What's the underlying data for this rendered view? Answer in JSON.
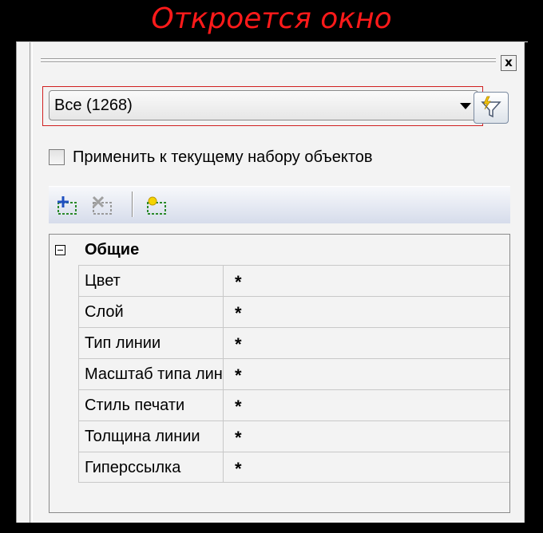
{
  "caption": "Откроется окно",
  "window": {
    "close_glyph": "x"
  },
  "dropdown": {
    "selected_value": "Все (1268)"
  },
  "filter_button": {
    "icon": "quick-select-filter-icon",
    "accent_color": "#f5c400"
  },
  "checkbox": {
    "label": "Применить к текущему набору объектов",
    "checked": false
  },
  "toolbar": {
    "icons": [
      "add-to-selection-icon",
      "remove-from-selection-icon",
      "new-selection-icon"
    ]
  },
  "properties": {
    "group_label": "Общие",
    "rows": [
      {
        "name": "Цвет",
        "value": "*"
      },
      {
        "name": "Слой",
        "value": "*"
      },
      {
        "name": "Тип линии",
        "value": "*"
      },
      {
        "name": "Масштаб типа линий",
        "value": "*"
      },
      {
        "name": "Стиль печати",
        "value": "*"
      },
      {
        "name": "Толщина линии",
        "value": "*"
      },
      {
        "name": "Гиперссылка",
        "value": "*"
      }
    ]
  }
}
